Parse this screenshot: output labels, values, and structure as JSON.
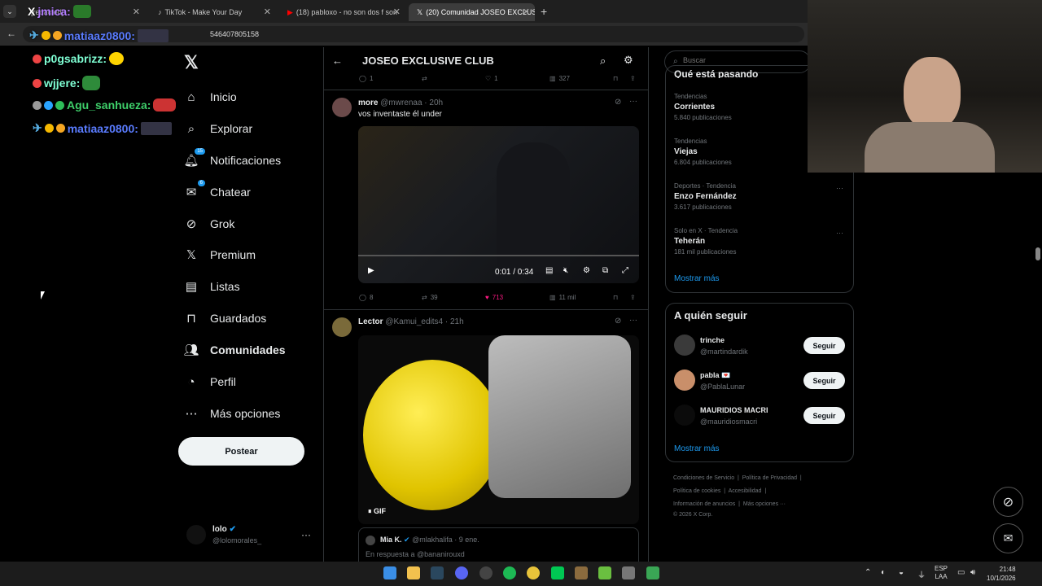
{
  "browser": {
    "tabs": [
      {
        "title": "[redacted]"
      },
      {
        "title": "TikTok - Make Your Day"
      },
      {
        "title": "(18) pabloxo - no son dos f son"
      },
      {
        "title": "(20) Comunidad JOSEO EXCLUS"
      }
    ],
    "url_fragment": "546407805158"
  },
  "chat": [
    {
      "user": "jmica:"
    },
    {
      "user": "matiaaz0800:"
    },
    {
      "user": "p0gsabrizz:"
    },
    {
      "user": "wjjere:"
    },
    {
      "user": "Agu_sanhueza:"
    },
    {
      "user": "matiaaz0800:"
    }
  ],
  "nav": {
    "items": [
      {
        "label": "Inicio",
        "icon": "home-icon"
      },
      {
        "label": "Explorar",
        "icon": "search-icon"
      },
      {
        "label": "Notificaciones",
        "icon": "bell-icon",
        "badge": "15"
      },
      {
        "label": "Chatear",
        "icon": "mail-icon",
        "badge": "6"
      },
      {
        "label": "Grok",
        "icon": "grok-icon"
      },
      {
        "label": "Premium",
        "icon": "x-icon"
      },
      {
        "label": "Listas",
        "icon": "list-icon"
      },
      {
        "label": "Guardados",
        "icon": "bookmark-icon"
      },
      {
        "label": "Comunidades",
        "icon": "people-icon"
      },
      {
        "label": "Perfil",
        "icon": "person-icon"
      },
      {
        "label": "Más opciones",
        "icon": "more-icon"
      }
    ],
    "post_label": "Postear",
    "account_name": "lolo",
    "account_handle": "@lolomorales_"
  },
  "feed": {
    "title": "JOSEO EXCLUSIVE CLUB",
    "top_actions": {
      "replies": "1",
      "likes": "1",
      "views": "327"
    },
    "tweet1": {
      "name": "more",
      "handle": "@mwrenaa",
      "time": "· 20h",
      "text": "vos inventaste él under",
      "video_time": "0:01 / 0:34",
      "replies": "8",
      "retweets": "39",
      "likes": "713",
      "views": "11 mil"
    },
    "tweet2": {
      "name": "Lector",
      "handle": "@Kamui_edits4",
      "time": "· 21h",
      "gif_label": "GIF",
      "quote_name": "Mia K.",
      "quote_handle": "@mlakhalifa",
      "quote_time": "· 9 ene.",
      "quote_text": "En respuesta a @bananirouxd"
    }
  },
  "search": {
    "placeholder": "Buscar"
  },
  "trends": {
    "header": "Qué está pasando",
    "items": [
      {
        "category": "Tendencias",
        "name": "Corrientes",
        "count": "5.840 publicaciones"
      },
      {
        "category": "Tendencias",
        "name": "Viejas",
        "count": "6.804 publicaciones"
      },
      {
        "category": "Deportes · Tendencia",
        "name": "Enzo Fernández",
        "count": "3.617 publicaciones"
      },
      {
        "category": "Solo en X · Tendencia",
        "name": "Teherán",
        "count": "181 mil publicaciones"
      }
    ],
    "more": "Mostrar más"
  },
  "follow": {
    "header": "A quién seguir",
    "items": [
      {
        "name": "trinche",
        "handle": "@martindardik"
      },
      {
        "name": "pabla 💌",
        "handle": "@PablaLunar"
      },
      {
        "name": "MAURIDIOS MACRI",
        "handle": "@mauridiosmacri"
      }
    ],
    "button": "Seguir",
    "more": "Mostrar más"
  },
  "footer": {
    "l1": [
      "Condiciones de Servicio",
      "Política de Privacidad"
    ],
    "l2": [
      "Política de cookies",
      "Accesibilidad"
    ],
    "l3": [
      "Información de anuncios",
      "Más opciones ···"
    ],
    "copy": "© 2026 X Corp."
  },
  "taskbar": {
    "lang": "ESP",
    "region": "LAA",
    "time": "21:48",
    "date": "10/1/2026"
  },
  "colors": {
    "accent": "#1d9bf0",
    "like": "#f91880"
  }
}
